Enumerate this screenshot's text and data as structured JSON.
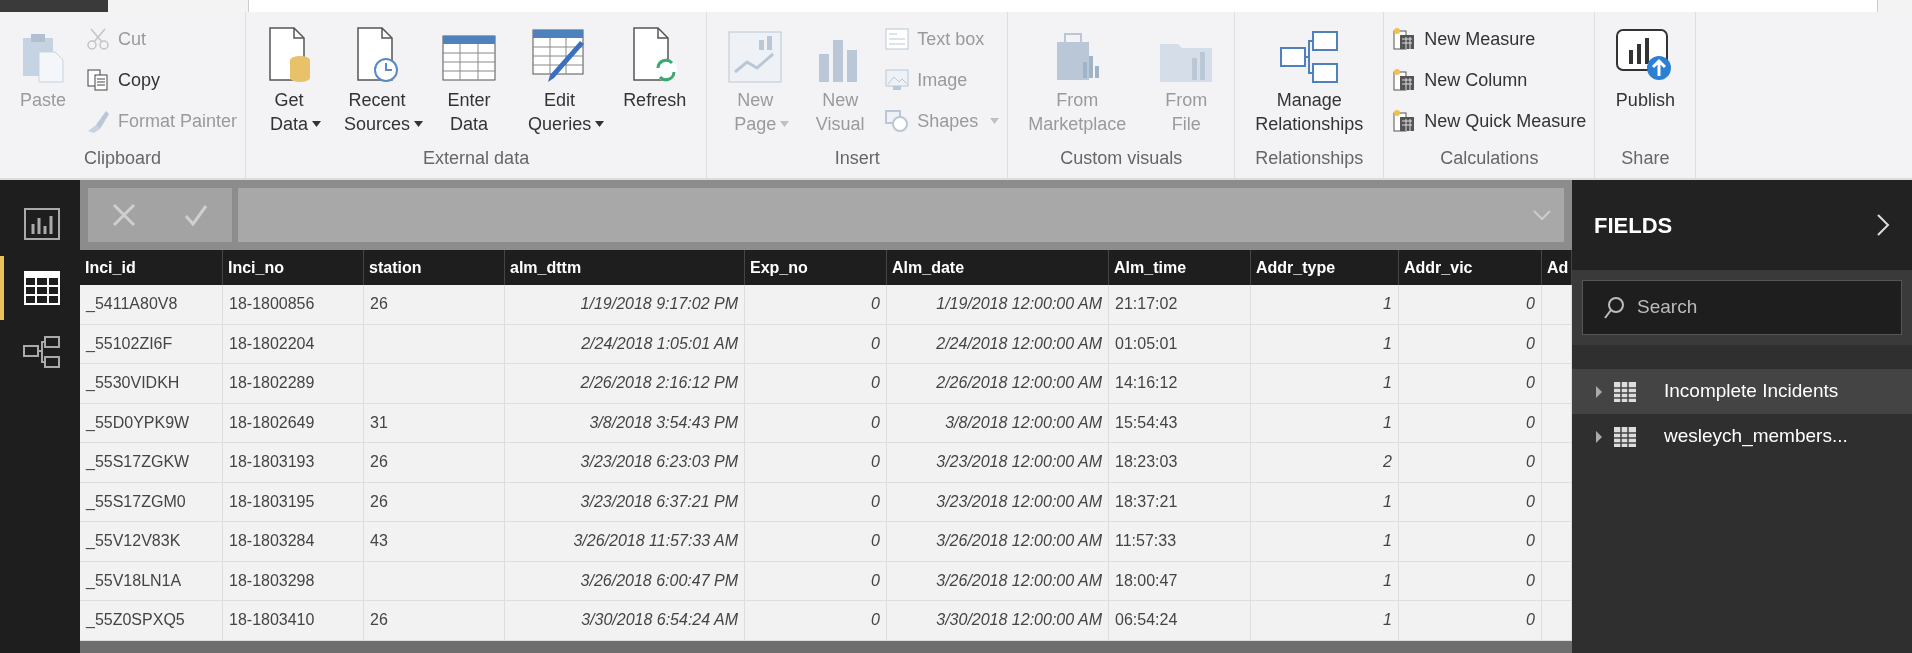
{
  "ribbon": {
    "groups": [
      {
        "label": "Clipboard",
        "items": [
          {
            "kind": "large",
            "label": "Paste",
            "disabled": true,
            "dropdown": false
          },
          {
            "kind": "stack",
            "entries": [
              {
                "label": "Cut",
                "disabled": true,
                "dropdown": false
              },
              {
                "label": "Copy",
                "disabled": false,
                "dropdown": false
              },
              {
                "label": "Format Painter",
                "disabled": true,
                "dropdown": false
              }
            ]
          }
        ]
      },
      {
        "label": "External data",
        "items": [
          {
            "kind": "large",
            "label": "Get Data",
            "disabled": false,
            "dropdown": true
          },
          {
            "kind": "large",
            "label": "Recent Sources",
            "disabled": false,
            "dropdown": true
          },
          {
            "kind": "large",
            "label": "Enter Data",
            "disabled": false,
            "dropdown": false
          },
          {
            "kind": "large",
            "label": "Edit Queries",
            "disabled": false,
            "dropdown": true
          },
          {
            "kind": "large",
            "label": "Refresh",
            "disabled": false,
            "dropdown": false
          }
        ]
      },
      {
        "label": "Insert",
        "items": [
          {
            "kind": "large",
            "label": "New Page",
            "disabled": true,
            "dropdown": true
          },
          {
            "kind": "large",
            "label": "New Visual",
            "disabled": true,
            "dropdown": false
          },
          {
            "kind": "stack",
            "entries": [
              {
                "label": "Text box",
                "disabled": true,
                "dropdown": false
              },
              {
                "label": "Image",
                "disabled": true,
                "dropdown": false
              },
              {
                "label": "Shapes",
                "disabled": true,
                "dropdown": true
              }
            ]
          }
        ]
      },
      {
        "label": "Custom visuals",
        "items": [
          {
            "kind": "large",
            "label": "From Marketplace",
            "disabled": true,
            "dropdown": false
          },
          {
            "kind": "large",
            "label": "From File",
            "disabled": true,
            "dropdown": false
          }
        ]
      },
      {
        "label": "Relationships",
        "items": [
          {
            "kind": "large",
            "label": "Manage Relationships",
            "disabled": false,
            "dropdown": false
          }
        ]
      },
      {
        "label": "Calculations",
        "items": [
          {
            "kind": "stack",
            "entries": [
              {
                "label": "New Measure",
                "disabled": false,
                "dropdown": false
              },
              {
                "label": "New Column",
                "disabled": false,
                "dropdown": false
              },
              {
                "label": "New Quick Measure",
                "disabled": false,
                "dropdown": false
              }
            ]
          }
        ]
      },
      {
        "label": "Share",
        "items": [
          {
            "kind": "large",
            "label": "Publish",
            "disabled": false,
            "dropdown": false
          }
        ]
      }
    ]
  },
  "nav": [
    {
      "selected": false
    },
    {
      "selected": true
    },
    {
      "selected": false
    }
  ],
  "table": {
    "columns": [
      {
        "label": "Inci_id",
        "kind": "text"
      },
      {
        "label": "Inci_no",
        "kind": "text"
      },
      {
        "label": "station",
        "kind": "text"
      },
      {
        "label": "alm_dttm",
        "kind": "number"
      },
      {
        "label": "Exp_no",
        "kind": "number"
      },
      {
        "label": "Alm_date",
        "kind": "number"
      },
      {
        "label": "Alm_time",
        "kind": "text"
      },
      {
        "label": "Addr_type",
        "kind": "number"
      },
      {
        "label": "Addr_vic",
        "kind": "number"
      },
      {
        "label": "Ad",
        "kind": "text"
      }
    ],
    "rows": [
      {
        "cells": [
          "_5411A80V8",
          "18-1800856",
          "26",
          "1/19/2018 9:17:02 PM",
          "0",
          "1/19/2018 12:00:00 AM",
          "21:17:02",
          "1",
          "0"
        ]
      },
      {
        "cells": [
          "_55102ZI6F",
          "18-1802204",
          null,
          "2/24/2018 1:05:01 AM",
          "0",
          "2/24/2018 12:00:00 AM",
          "01:05:01",
          "1",
          "0"
        ]
      },
      {
        "cells": [
          "_5530VIDKH",
          "18-1802289",
          null,
          "2/26/2018 2:16:12 PM",
          "0",
          "2/26/2018 12:00:00 AM",
          "14:16:12",
          "1",
          "0"
        ]
      },
      {
        "cells": [
          "_55D0YPK9W",
          "18-1802649",
          "31",
          "3/8/2018 3:54:43 PM",
          "0",
          "3/8/2018 12:00:00 AM",
          "15:54:43",
          "1",
          "0"
        ]
      },
      {
        "cells": [
          "_55S17ZGKW",
          "18-1803193",
          "26",
          "3/23/2018 6:23:03 PM",
          "0",
          "3/23/2018 12:00:00 AM",
          "18:23:03",
          "2",
          "0"
        ]
      },
      {
        "cells": [
          "_55S17ZGM0",
          "18-1803195",
          "26",
          "3/23/2018 6:37:21 PM",
          "0",
          "3/23/2018 12:00:00 AM",
          "18:37:21",
          "1",
          "0"
        ]
      },
      {
        "cells": [
          "_55V12V83K",
          "18-1803284",
          "43",
          "3/26/2018 11:57:33 AM",
          "0",
          "3/26/2018 12:00:00 AM",
          "11:57:33",
          "1",
          "0"
        ]
      },
      {
        "cells": [
          "_55V18LN1A",
          "18-1803298",
          null,
          "3/26/2018 6:00:47 PM",
          "0",
          "3/26/2018 12:00:00 AM",
          "18:00:47",
          "1",
          "0"
        ]
      },
      {
        "cells": [
          "_55Z0SPXQ5",
          "18-1803410",
          "26",
          "3/30/2018 6:54:24 AM",
          "0",
          "3/30/2018 12:00:00 AM",
          "06:54:24",
          "1",
          "0"
        ]
      }
    ]
  },
  "fields": {
    "title": "FIELDS",
    "search": {
      "placeholder": "Search"
    },
    "tables": [
      {
        "label": "Incomplete Incidents",
        "selected": true
      },
      {
        "label": "wesleych_members...",
        "selected": false
      }
    ]
  }
}
